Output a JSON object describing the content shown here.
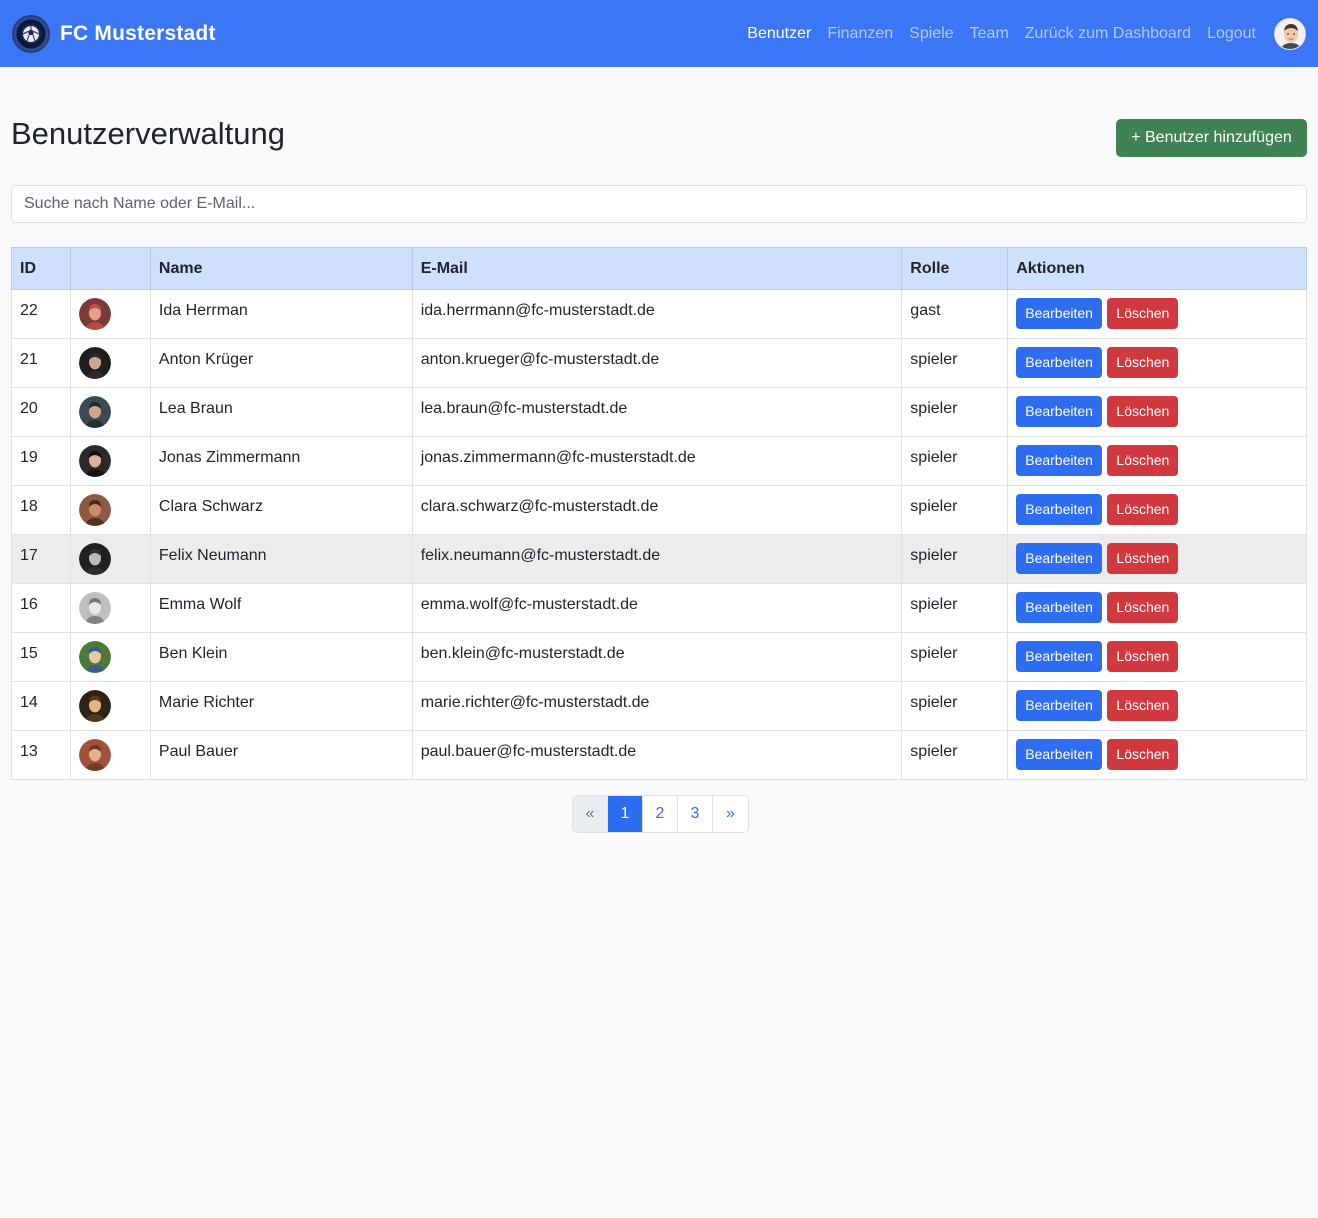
{
  "navbar": {
    "brand": "FC Musterstadt",
    "links": [
      {
        "label": "Benutzer",
        "active": true
      },
      {
        "label": "Finanzen"
      },
      {
        "label": "Spiele"
      },
      {
        "label": "Team"
      },
      {
        "label": "Zurück zum Dashboard"
      },
      {
        "label": "Logout"
      }
    ],
    "avatar_icon": "user-avatar-icon"
  },
  "page": {
    "title": "Benutzerverwaltung",
    "add_button": "+ Benutzer hinzufügen"
  },
  "search": {
    "placeholder": "Suche nach Name oder E-Mail...",
    "value": ""
  },
  "table": {
    "headers": [
      "ID",
      "",
      "Name",
      "E-Mail",
      "Rolle",
      "Aktionen"
    ],
    "edit_label": "Bearbeiten",
    "delete_label": "Löschen",
    "rows": [
      {
        "id": "22",
        "name": "Ida Herrman",
        "email": "ida.herrmann@fc-musterstadt.de",
        "role": "gast"
      },
      {
        "id": "21",
        "name": "Anton Krüger",
        "email": "anton.krueger@fc-musterstadt.de",
        "role": "spieler"
      },
      {
        "id": "20",
        "name": "Lea Braun",
        "email": "lea.braun@fc-musterstadt.de",
        "role": "spieler"
      },
      {
        "id": "19",
        "name": "Jonas Zimmermann",
        "email": "jonas.zimmermann@fc-musterstadt.de",
        "role": "spieler"
      },
      {
        "id": "18",
        "name": "Clara Schwarz",
        "email": "clara.schwarz@fc-musterstadt.de",
        "role": "spieler"
      },
      {
        "id": "17",
        "name": "Felix Neumann",
        "email": "felix.neumann@fc-musterstadt.de",
        "role": "spieler"
      },
      {
        "id": "16",
        "name": "Emma Wolf",
        "email": "emma.wolf@fc-musterstadt.de",
        "role": "spieler"
      },
      {
        "id": "15",
        "name": "Ben Klein",
        "email": "ben.klein@fc-musterstadt.de",
        "role": "spieler"
      },
      {
        "id": "14",
        "name": "Marie Richter",
        "email": "marie.richter@fc-musterstadt.de",
        "role": "spieler"
      },
      {
        "id": "13",
        "name": "Paul Bauer",
        "email": "paul.bauer@fc-musterstadt.de",
        "role": "spieler"
      }
    ]
  },
  "pagination": {
    "prev": "«",
    "pages": [
      "1",
      "2",
      "3"
    ],
    "current": "1",
    "next": "»"
  },
  "colors": {
    "navbar": "#3b76f5",
    "add_button": "#3f8354",
    "edit_button": "#2f6df0",
    "delete_button": "#d0393f",
    "table_header": "#cfe0fc"
  }
}
